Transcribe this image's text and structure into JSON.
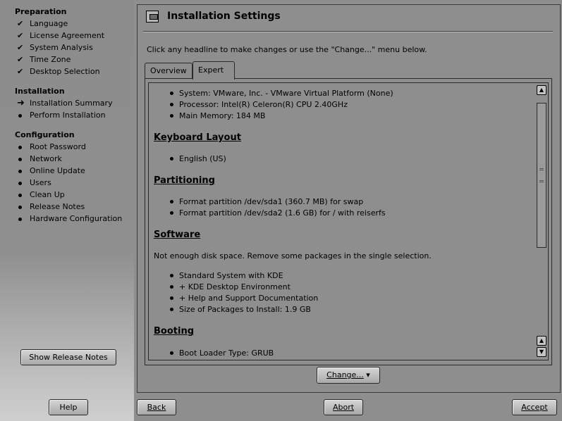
{
  "sidebar": {
    "sections": [
      {
        "title": "Preparation",
        "items": [
          {
            "label": "Language",
            "state": "done"
          },
          {
            "label": "License Agreement",
            "state": "done"
          },
          {
            "label": "System Analysis",
            "state": "done"
          },
          {
            "label": "Time Zone",
            "state": "done"
          },
          {
            "label": "Desktop Selection",
            "state": "done"
          }
        ]
      },
      {
        "title": "Installation",
        "items": [
          {
            "label": "Installation Summary",
            "state": "current"
          },
          {
            "label": "Perform Installation",
            "state": "pending"
          }
        ]
      },
      {
        "title": "Configuration",
        "items": [
          {
            "label": "Root Password",
            "state": "pending"
          },
          {
            "label": "Network",
            "state": "pending"
          },
          {
            "label": "Online Update",
            "state": "pending"
          },
          {
            "label": "Users",
            "state": "pending"
          },
          {
            "label": "Clean Up",
            "state": "pending"
          },
          {
            "label": "Release Notes",
            "state": "pending"
          },
          {
            "label": "Hardware Configuration",
            "state": "pending"
          }
        ]
      }
    ],
    "release_notes_button": "Show Release Notes"
  },
  "main": {
    "title": "Installation Settings",
    "instructions": "Click any headline to make changes or use the \"Change...\" menu below.",
    "tabs": [
      {
        "label": "Overview",
        "selected": false
      },
      {
        "label": "Expert",
        "selected": true
      }
    ],
    "content": {
      "system_items": [
        "System: VMware, Inc. - VMware Virtual Platform (None)",
        "Processor: Intel(R) Celeron(R) CPU 2.40GHz",
        "Main Memory: 184 MB"
      ],
      "keyboard": {
        "heading": "Keyboard Layout",
        "items": [
          "English (US)"
        ]
      },
      "partitioning": {
        "heading": "Partitioning",
        "items": [
          "Format partition /dev/sda1 (360.7 MB) for swap",
          "Format partition /dev/sda2 (1.6 GB) for / with reiserfs"
        ]
      },
      "software": {
        "heading": "Software",
        "warning": "Not enough disk space. Remove some packages in the single selection.",
        "items": [
          "Standard System with KDE",
          "+ KDE Desktop Environment",
          "+ Help and Support Documentation",
          "Size of Packages to Install: 1.9 GB"
        ]
      },
      "booting": {
        "heading": "Booting",
        "items": [
          "Boot Loader Type: GRUB"
        ]
      }
    },
    "change_button": "Change...",
    "change_arrow": "▾"
  },
  "footer": {
    "help": "Help",
    "back": "Back",
    "abort": "Abort",
    "accept": "Accept"
  },
  "icons": {
    "check": "✔",
    "arrow": "➜"
  }
}
